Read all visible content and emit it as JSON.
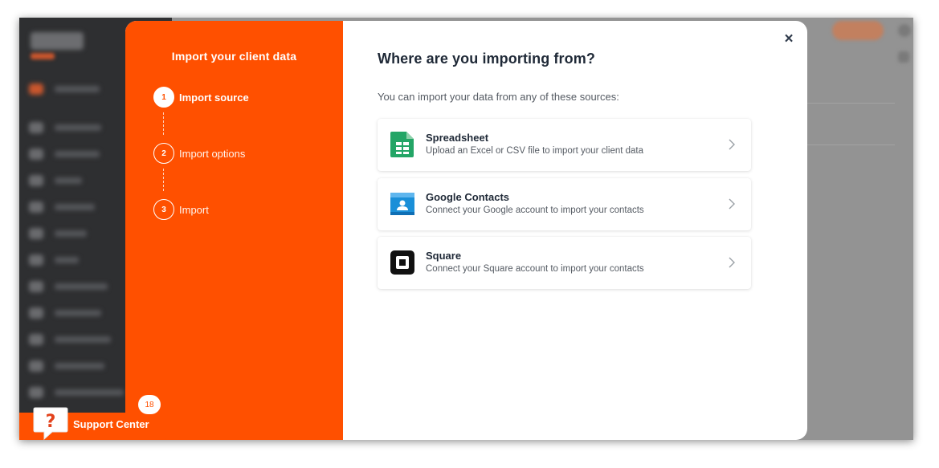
{
  "modal": {
    "steps_title": "Import your client data",
    "steps": [
      {
        "number": "1",
        "label": "Import source",
        "active": true
      },
      {
        "number": "2",
        "label": "Import options",
        "active": false
      },
      {
        "number": "3",
        "label": "Import",
        "active": false
      }
    ],
    "close_icon": "×",
    "title": "Where are you importing from?",
    "subtitle": "You can import your data from any of these sources:",
    "sources": [
      {
        "icon": "spreadsheet-icon",
        "title": "Spreadsheet",
        "description": "Upload an Excel or CSV file to import your client data"
      },
      {
        "icon": "google-contacts-icon",
        "title": "Google Contacts",
        "description": "Connect your Google account to import your contacts"
      },
      {
        "icon": "square-icon",
        "title": "Square",
        "description": "Connect your Square account to import your contacts"
      }
    ]
  },
  "support": {
    "label": "Support Center",
    "badge": "18"
  },
  "colors": {
    "accent": "#ff5000",
    "sidebar": "#2e2f31",
    "overlay": "#939393"
  }
}
